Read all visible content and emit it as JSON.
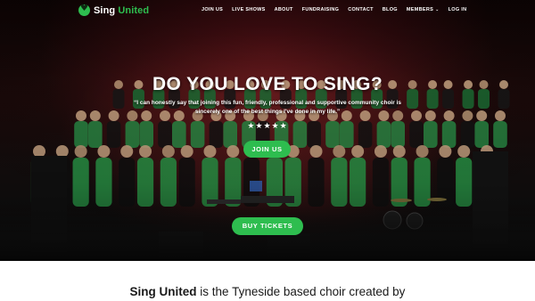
{
  "brand": {
    "name_part1": "Sing",
    "name_part2": "United",
    "accent_color": "#2ebd4f"
  },
  "nav": {
    "items": [
      {
        "label": "JOIN US"
      },
      {
        "label": "LIVE SHOWS"
      },
      {
        "label": "ABOUT"
      },
      {
        "label": "FUNDRAISING"
      },
      {
        "label": "CONTACT"
      },
      {
        "label": "BLOG"
      },
      {
        "label": "MEMBERS",
        "has_dropdown": true
      },
      {
        "label": "LOG IN"
      }
    ],
    "dropdown_icon": "chevron-down-icon"
  },
  "hero": {
    "title": "DO YOU LOVE TO SING?",
    "quote_line1": "“I can honestly say that joining this fun, friendly, professional and supportive community choir is",
    "quote_line2": "sincerely one of the best things I've done in my life.”",
    "stars": "★★★★★",
    "rating": 5,
    "join_button": "JOIN US",
    "tickets_button": "BUY TICKETS"
  },
  "intro": {
    "brand": "Sing United",
    "text": " is the Tyneside based choir created by"
  },
  "colors": {
    "button": "#2ebd4f",
    "hero_dark": "#140606"
  }
}
